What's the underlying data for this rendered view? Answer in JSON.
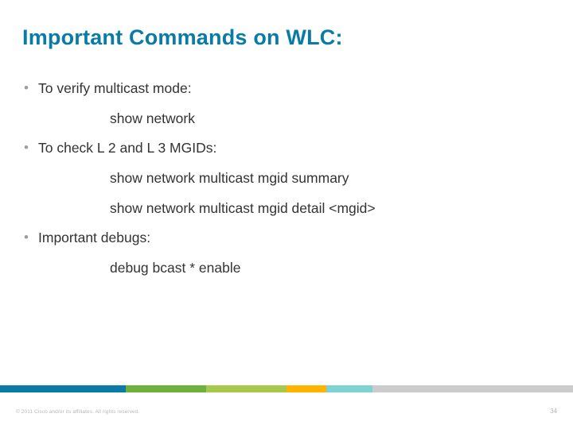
{
  "title": "Important Commands on WLC:",
  "bullets": [
    {
      "label": "To verify multicast mode:",
      "commands": [
        "show network"
      ]
    },
    {
      "label": "To check L 2 and L 3 MGIDs:",
      "commands": [
        "show network multicast mgid summary",
        "show network multicast mgid detail <mgid>"
      ]
    },
    {
      "label": "Important debugs:",
      "commands": [
        "debug bcast * enable"
      ]
    }
  ],
  "footer": {
    "copyright": "© 2011 Cisco and/or its affiliates. All rights reserved.",
    "page": "34"
  }
}
